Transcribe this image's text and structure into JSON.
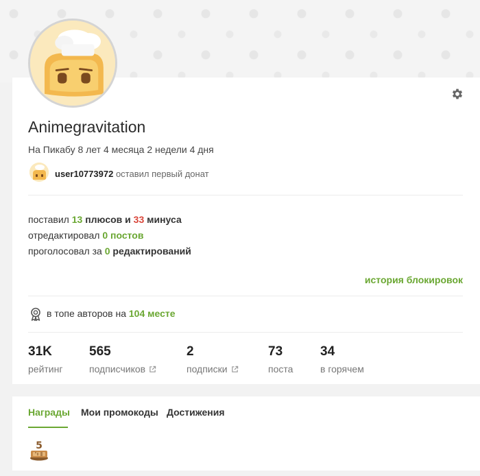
{
  "profile": {
    "username": "Animegravitation",
    "member_since": "На Пикабу 8 лет 4 месяца 2 недели 4 дня"
  },
  "donation": {
    "user": "user10773972",
    "text": "оставил первый донат"
  },
  "activity": {
    "votes_prefix": "поставил",
    "pluses": "13",
    "pluses_word": "плюсов и",
    "minuses": "33",
    "minuses_word": "минуса",
    "edited_prefix": "отредактировал",
    "edited_posts": "0 постов",
    "voted_prefix": "проголосовал за",
    "voted_count": "0",
    "voted_word": "редактирований"
  },
  "block_history_link": "история блокировок",
  "rank": {
    "prefix": "в топе авторов на",
    "place": "104 месте"
  },
  "stats": [
    {
      "value": "31K",
      "label": "рейтинг"
    },
    {
      "value": "565",
      "label": "подписчиков"
    },
    {
      "value": "2",
      "label": "подписки"
    },
    {
      "value": "73",
      "label": "поста"
    },
    {
      "value": "34",
      "label": "в горячем"
    }
  ],
  "tabs": [
    {
      "label": "Награды",
      "active": true
    },
    {
      "label": "Мои промокоды",
      "active": false
    },
    {
      "label": "Достижения",
      "active": false
    }
  ],
  "award_badge_text": "5",
  "colors": {
    "accent_green": "#6aa732",
    "minus_red": "#d9463a"
  }
}
